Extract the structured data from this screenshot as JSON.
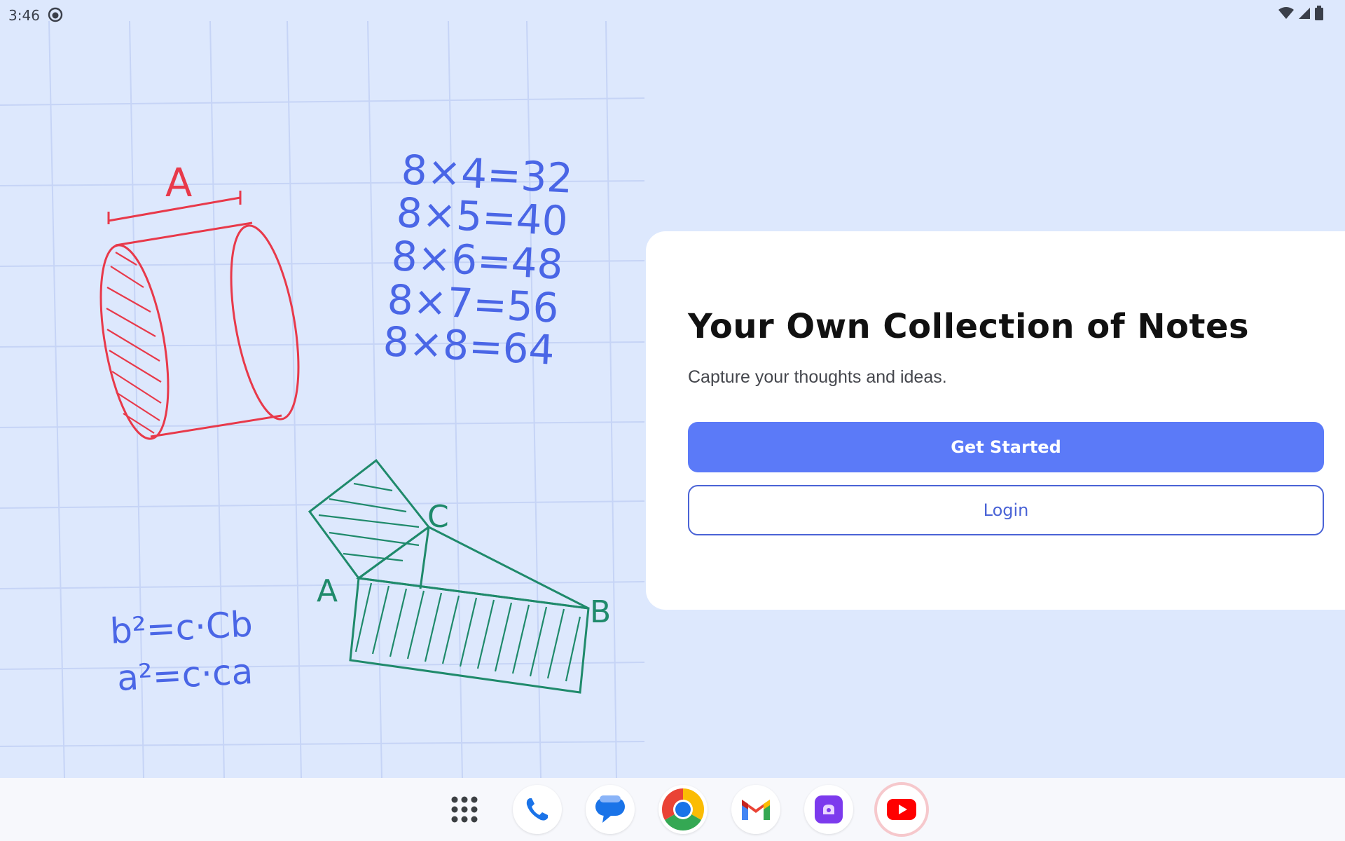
{
  "status_bar": {
    "time": "3:46",
    "icons": [
      "notification-face-icon",
      "wifi-icon",
      "signal-icon",
      "battery-icon"
    ]
  },
  "illustration": {
    "label_a_top": "A",
    "equations": [
      "8×4=32",
      "8×5=40",
      "8×6=48",
      "8×7=56",
      "8×8=64"
    ],
    "formula_b": "b²=c·Cb",
    "formula_a": "a²=c·ca",
    "vertex_c": "C",
    "vertex_a": "A",
    "vertex_b": "B",
    "colors": {
      "red": "#e8394a",
      "blue": "#4a66e6",
      "green": "#1f8a6b"
    }
  },
  "card": {
    "title": "Your Own Collection of Notes",
    "subtitle": "Capture your thoughts and ideas.",
    "primary_button": "Get Started",
    "secondary_button": "Login",
    "accent": "#5b7af8"
  },
  "taskbar": {
    "apps": [
      "app-drawer-icon",
      "phone-icon",
      "messages-icon",
      "chrome-icon",
      "gmail-icon",
      "notes-app-icon",
      "youtube-icon"
    ]
  }
}
